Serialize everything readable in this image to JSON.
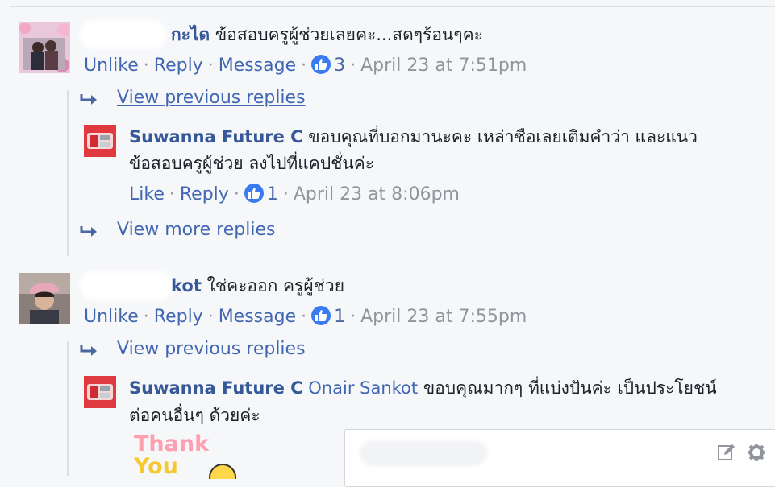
{
  "comment1": {
    "name_suffix": "กะได",
    "text": "ข้อสอบครูผู้ช่วยเลยคะ...สดๆร้อนๆคะ",
    "actions": {
      "unlike": "Unlike",
      "reply": "Reply",
      "message": "Message",
      "likes": "3",
      "time": "April 23 at 7:51pm"
    },
    "view_previous": "View previous replies",
    "reply": {
      "name": "Suwanna Future C",
      "text_line1": "ขอบคุณที่บอกมานะคะ เหล่าซือเลยเติมคำว่า และแนว",
      "text_line2": "ข้อสอบครูผู้ช่วย ลงไปที่แคปชั่นค่ะ",
      "actions": {
        "like": "Like",
        "reply": "Reply",
        "likes": "1",
        "time": "April 23 at 8:06pm"
      }
    },
    "view_more": "View more replies"
  },
  "comment2": {
    "name_suffix": "kot",
    "text": "ใช่คะออก ครูผู้ช่วย",
    "actions": {
      "unlike": "Unlike",
      "reply": "Reply",
      "message": "Message",
      "likes": "1",
      "time": "April 23 at 7:55pm"
    },
    "view_previous": "View previous replies",
    "reply": {
      "name": "Suwanna Future C",
      "mention": "Onair Sankot",
      "text_line1": "ขอบคุณมากๆ ที่แบ่งปันค่ะ เป็นประโยชน์",
      "text_line2": "ต่อคนอื่นๆ ด้วยค่ะ",
      "sticker_line1": "Thank",
      "sticker_line2": "You"
    }
  },
  "icons": {
    "like": "thumbs-up-icon",
    "reply_arrow": "reply-arrow-icon",
    "compose": "compose-icon",
    "settings": "gear-icon"
  },
  "colors": {
    "link": "#4267b2",
    "name": "#365899",
    "meta": "#90949c",
    "like_badge": "#3b7bf0",
    "background": "#f6f7f9"
  }
}
